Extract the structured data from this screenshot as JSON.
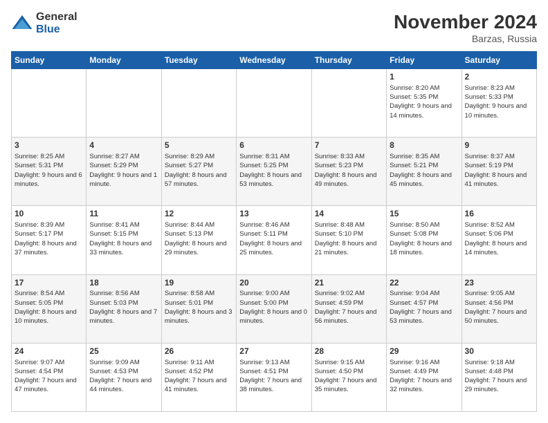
{
  "header": {
    "logo_general": "General",
    "logo_blue": "Blue",
    "month_title": "November 2024",
    "location": "Barzas, Russia"
  },
  "days_of_week": [
    "Sunday",
    "Monday",
    "Tuesday",
    "Wednesday",
    "Thursday",
    "Friday",
    "Saturday"
  ],
  "weeks": [
    {
      "shaded": false,
      "days": [
        {
          "num": "",
          "info": ""
        },
        {
          "num": "",
          "info": ""
        },
        {
          "num": "",
          "info": ""
        },
        {
          "num": "",
          "info": ""
        },
        {
          "num": "",
          "info": ""
        },
        {
          "num": "1",
          "info": "Sunrise: 8:20 AM\nSunset: 5:35 PM\nDaylight: 9 hours and 14 minutes."
        },
        {
          "num": "2",
          "info": "Sunrise: 8:23 AM\nSunset: 5:33 PM\nDaylight: 9 hours and 10 minutes."
        }
      ]
    },
    {
      "shaded": true,
      "days": [
        {
          "num": "3",
          "info": "Sunrise: 8:25 AM\nSunset: 5:31 PM\nDaylight: 9 hours and 6 minutes."
        },
        {
          "num": "4",
          "info": "Sunrise: 8:27 AM\nSunset: 5:29 PM\nDaylight: 9 hours and 1 minute."
        },
        {
          "num": "5",
          "info": "Sunrise: 8:29 AM\nSunset: 5:27 PM\nDaylight: 8 hours and 57 minutes."
        },
        {
          "num": "6",
          "info": "Sunrise: 8:31 AM\nSunset: 5:25 PM\nDaylight: 8 hours and 53 minutes."
        },
        {
          "num": "7",
          "info": "Sunrise: 8:33 AM\nSunset: 5:23 PM\nDaylight: 8 hours and 49 minutes."
        },
        {
          "num": "8",
          "info": "Sunrise: 8:35 AM\nSunset: 5:21 PM\nDaylight: 8 hours and 45 minutes."
        },
        {
          "num": "9",
          "info": "Sunrise: 8:37 AM\nSunset: 5:19 PM\nDaylight: 8 hours and 41 minutes."
        }
      ]
    },
    {
      "shaded": false,
      "days": [
        {
          "num": "10",
          "info": "Sunrise: 8:39 AM\nSunset: 5:17 PM\nDaylight: 8 hours and 37 minutes."
        },
        {
          "num": "11",
          "info": "Sunrise: 8:41 AM\nSunset: 5:15 PM\nDaylight: 8 hours and 33 minutes."
        },
        {
          "num": "12",
          "info": "Sunrise: 8:44 AM\nSunset: 5:13 PM\nDaylight: 8 hours and 29 minutes."
        },
        {
          "num": "13",
          "info": "Sunrise: 8:46 AM\nSunset: 5:11 PM\nDaylight: 8 hours and 25 minutes."
        },
        {
          "num": "14",
          "info": "Sunrise: 8:48 AM\nSunset: 5:10 PM\nDaylight: 8 hours and 21 minutes."
        },
        {
          "num": "15",
          "info": "Sunrise: 8:50 AM\nSunset: 5:08 PM\nDaylight: 8 hours and 18 minutes."
        },
        {
          "num": "16",
          "info": "Sunrise: 8:52 AM\nSunset: 5:06 PM\nDaylight: 8 hours and 14 minutes."
        }
      ]
    },
    {
      "shaded": true,
      "days": [
        {
          "num": "17",
          "info": "Sunrise: 8:54 AM\nSunset: 5:05 PM\nDaylight: 8 hours and 10 minutes."
        },
        {
          "num": "18",
          "info": "Sunrise: 8:56 AM\nSunset: 5:03 PM\nDaylight: 8 hours and 7 minutes."
        },
        {
          "num": "19",
          "info": "Sunrise: 8:58 AM\nSunset: 5:01 PM\nDaylight: 8 hours and 3 minutes."
        },
        {
          "num": "20",
          "info": "Sunrise: 9:00 AM\nSunset: 5:00 PM\nDaylight: 8 hours and 0 minutes."
        },
        {
          "num": "21",
          "info": "Sunrise: 9:02 AM\nSunset: 4:59 PM\nDaylight: 7 hours and 56 minutes."
        },
        {
          "num": "22",
          "info": "Sunrise: 9:04 AM\nSunset: 4:57 PM\nDaylight: 7 hours and 53 minutes."
        },
        {
          "num": "23",
          "info": "Sunrise: 9:05 AM\nSunset: 4:56 PM\nDaylight: 7 hours and 50 minutes."
        }
      ]
    },
    {
      "shaded": false,
      "days": [
        {
          "num": "24",
          "info": "Sunrise: 9:07 AM\nSunset: 4:54 PM\nDaylight: 7 hours and 47 minutes."
        },
        {
          "num": "25",
          "info": "Sunrise: 9:09 AM\nSunset: 4:53 PM\nDaylight: 7 hours and 44 minutes."
        },
        {
          "num": "26",
          "info": "Sunrise: 9:11 AM\nSunset: 4:52 PM\nDaylight: 7 hours and 41 minutes."
        },
        {
          "num": "27",
          "info": "Sunrise: 9:13 AM\nSunset: 4:51 PM\nDaylight: 7 hours and 38 minutes."
        },
        {
          "num": "28",
          "info": "Sunrise: 9:15 AM\nSunset: 4:50 PM\nDaylight: 7 hours and 35 minutes."
        },
        {
          "num": "29",
          "info": "Sunrise: 9:16 AM\nSunset: 4:49 PM\nDaylight: 7 hours and 32 minutes."
        },
        {
          "num": "30",
          "info": "Sunrise: 9:18 AM\nSunset: 4:48 PM\nDaylight: 7 hours and 29 minutes."
        }
      ]
    }
  ]
}
